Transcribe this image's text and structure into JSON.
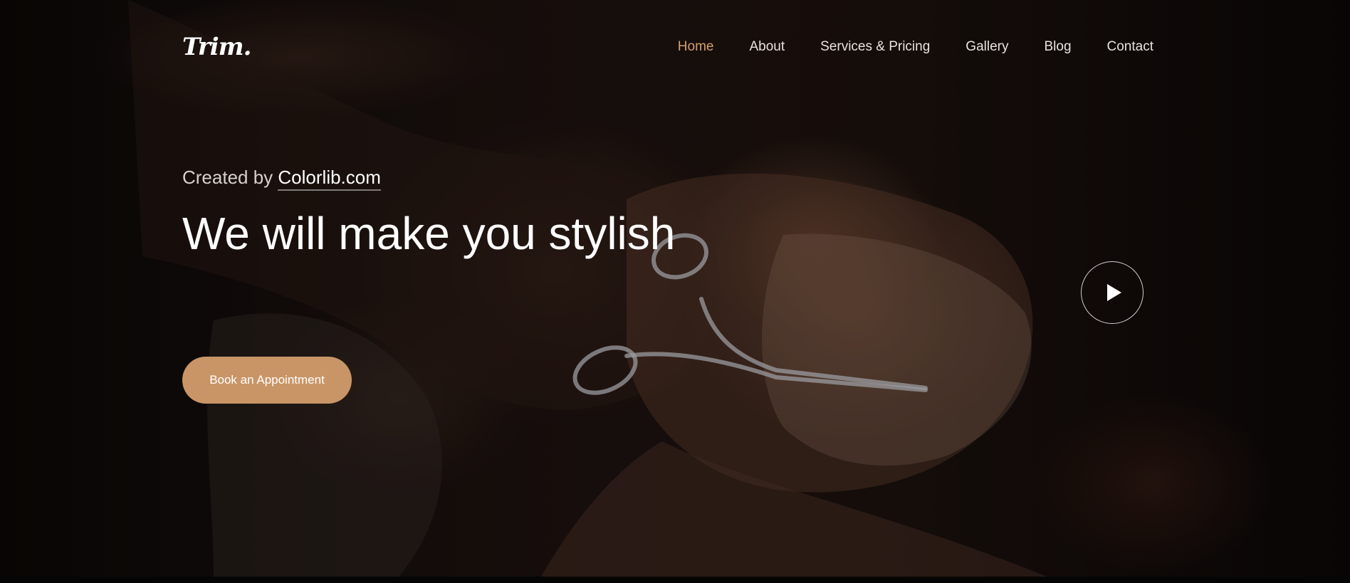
{
  "brand": {
    "logo_text": "Trim."
  },
  "nav": {
    "items": [
      {
        "label": "Home",
        "active": true
      },
      {
        "label": "About",
        "active": false
      },
      {
        "label": "Services & Pricing",
        "active": false
      },
      {
        "label": "Gallery",
        "active": false
      },
      {
        "label": "Blog",
        "active": false
      },
      {
        "label": "Contact",
        "active": false
      }
    ]
  },
  "hero": {
    "credit_prefix": "Created by ",
    "credit_link": "Colorlib.com",
    "headline": "We will make you stylish",
    "cta_label": "Book an Appointment",
    "play_icon": "play-icon",
    "background_image": "barber trimming a bearded man's mustache with scissors"
  },
  "colors": {
    "accent": "#d2a06e",
    "button": "#c99566",
    "text": "#ffffff",
    "background": "#140d0b"
  }
}
